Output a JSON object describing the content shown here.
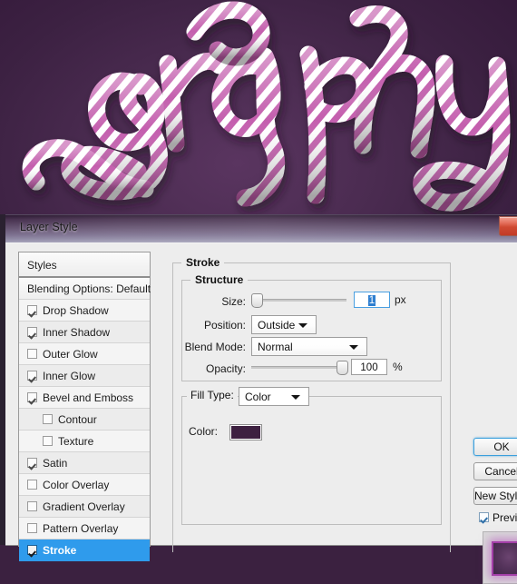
{
  "artwork": {
    "name": "candy-cane-lettering",
    "word": "graphy",
    "background_color": "#4a2b50",
    "stripe_color": "#c45fae",
    "stripe_highlight": "#ffffff"
  },
  "window": {
    "title": "Layer Style",
    "close_label": "✕",
    "titlebar_color": "#6b5a78",
    "close_color": "#cf4a33"
  },
  "styles_panel": {
    "header": "Styles",
    "blending_options": "Blending Options: Default",
    "items": [
      {
        "label": "Drop Shadow",
        "checked": true,
        "indent": false,
        "selected": false
      },
      {
        "label": "Inner Shadow",
        "checked": true,
        "indent": false,
        "selected": false
      },
      {
        "label": "Outer Glow",
        "checked": false,
        "indent": false,
        "selected": false
      },
      {
        "label": "Inner Glow",
        "checked": true,
        "indent": false,
        "selected": false
      },
      {
        "label": "Bevel and Emboss",
        "checked": true,
        "indent": false,
        "selected": false
      },
      {
        "label": "Contour",
        "checked": false,
        "indent": true,
        "selected": false
      },
      {
        "label": "Texture",
        "checked": false,
        "indent": true,
        "selected": false
      },
      {
        "label": "Satin",
        "checked": true,
        "indent": false,
        "selected": false
      },
      {
        "label": "Color Overlay",
        "checked": false,
        "indent": false,
        "selected": false
      },
      {
        "label": "Gradient Overlay",
        "checked": false,
        "indent": false,
        "selected": false
      },
      {
        "label": "Pattern Overlay",
        "checked": false,
        "indent": false,
        "selected": false
      },
      {
        "label": "Stroke",
        "checked": true,
        "indent": false,
        "selected": true
      }
    ],
    "selection_color": "#2f9bec"
  },
  "stroke_panel": {
    "title": "Stroke",
    "structure": {
      "title": "Structure",
      "size_label": "Size:",
      "size_value": "1",
      "size_unit": "px",
      "size_slider_percent": 2,
      "position_label": "Position:",
      "position_value": "Outside",
      "blend_mode_label": "Blend Mode:",
      "blend_mode_value": "Normal",
      "opacity_label": "Opacity:",
      "opacity_value": "100",
      "opacity_unit": "%",
      "opacity_slider_percent": 100
    },
    "fill": {
      "fill_type_label": "Fill Type:",
      "fill_type_value": "Color",
      "color_label": "Color:",
      "color_value": "#3d2040"
    }
  },
  "buttons": {
    "ok": "OK",
    "cancel": "Cancel",
    "new_style": "New Style...",
    "preview_label": "Preview",
    "preview_checked": true
  }
}
